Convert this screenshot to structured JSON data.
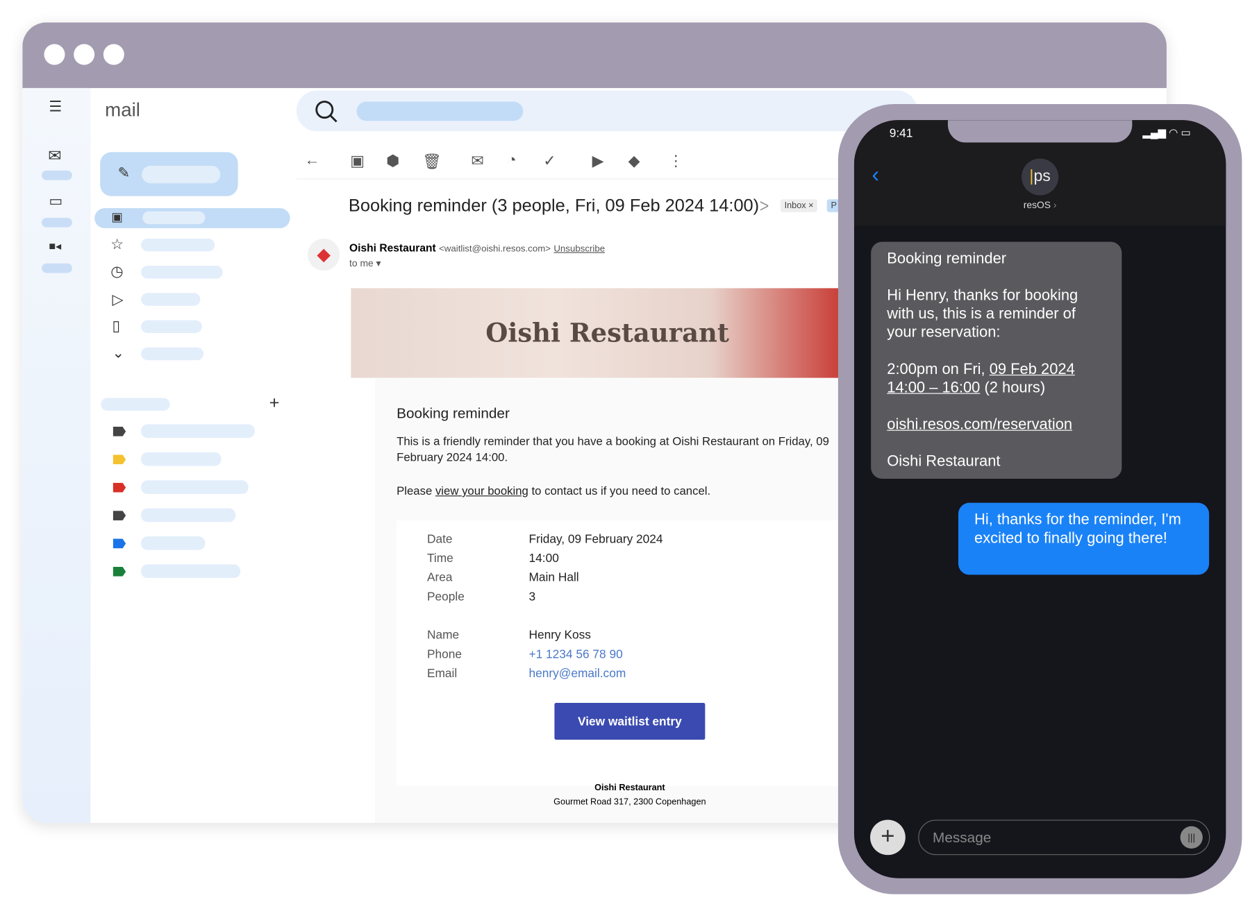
{
  "app": {
    "logo": "mail"
  },
  "toolbar": {
    "icons": [
      "back-arrow",
      "archive",
      "report-spam",
      "delete",
      "mark-unread",
      "snooze",
      "add-task",
      "move-to",
      "label",
      "more"
    ]
  },
  "email": {
    "subject": "Booking reminder (3 people, Fri, 09 Feb 2024 14:00)",
    "tags": [
      "Inbox ×",
      "P"
    ],
    "sender_name": "Oishi Restaurant",
    "sender_email": "<waitlist@oishi.resos.com>",
    "unsubscribe": "Unsubscribe",
    "to": "to me ▾",
    "banner_title": "Oishi Restaurant",
    "heading": "Booking reminder",
    "para1": "This is a friendly reminder that you have a booking at Oishi Restaurant on Friday, 09 February 2024 14:00.",
    "para2_pre": "Please ",
    "para2_link": "view your booking",
    "para2_post": " to contact us if you need to cancel.",
    "details": [
      {
        "label": "Date",
        "value": "Friday, 09 February 2024"
      },
      {
        "label": "Time",
        "value": "14:00"
      },
      {
        "label": "Area",
        "value": "Main Hall"
      },
      {
        "label": "People",
        "value": "3"
      }
    ],
    "contact": [
      {
        "label": "Name",
        "value": "Henry Koss"
      },
      {
        "label": "Phone",
        "value": "+1 1234 56 78 90"
      },
      {
        "label": "Email",
        "value": "henry@email.com"
      }
    ],
    "button": "View waitlist entry",
    "footer_name": "Oishi Restaurant",
    "footer_address": "Gourmet Road 317, 2300 Copenhagen"
  },
  "phone": {
    "time": "9:41",
    "contact": "resOS",
    "avatar_text": "ps",
    "incoming": {
      "title": "Booking reminder",
      "body": "Hi Henry, thanks for booking with us, this is a reminder of your reservation:",
      "when_pre": "2:00pm on Fri, ",
      "when_link": "09 Feb 2024 14:00 – 16:00",
      "when_post": " (2 hours)",
      "url": "oishi.resos.com/reservation",
      "sign": "Oishi Restaurant"
    },
    "outgoing": "Hi, thanks for the reminder, I'm excited to finally going there!",
    "input_placeholder": "Message"
  },
  "colors": {
    "frame": "#a39bb0",
    "accent": "#3a4ab0",
    "imessage_blue": "#1a82f7",
    "label_colors": [
      "#444444",
      "#f5c12e",
      "#d93025",
      "#444444",
      "#1a73e8",
      "#188038"
    ]
  }
}
